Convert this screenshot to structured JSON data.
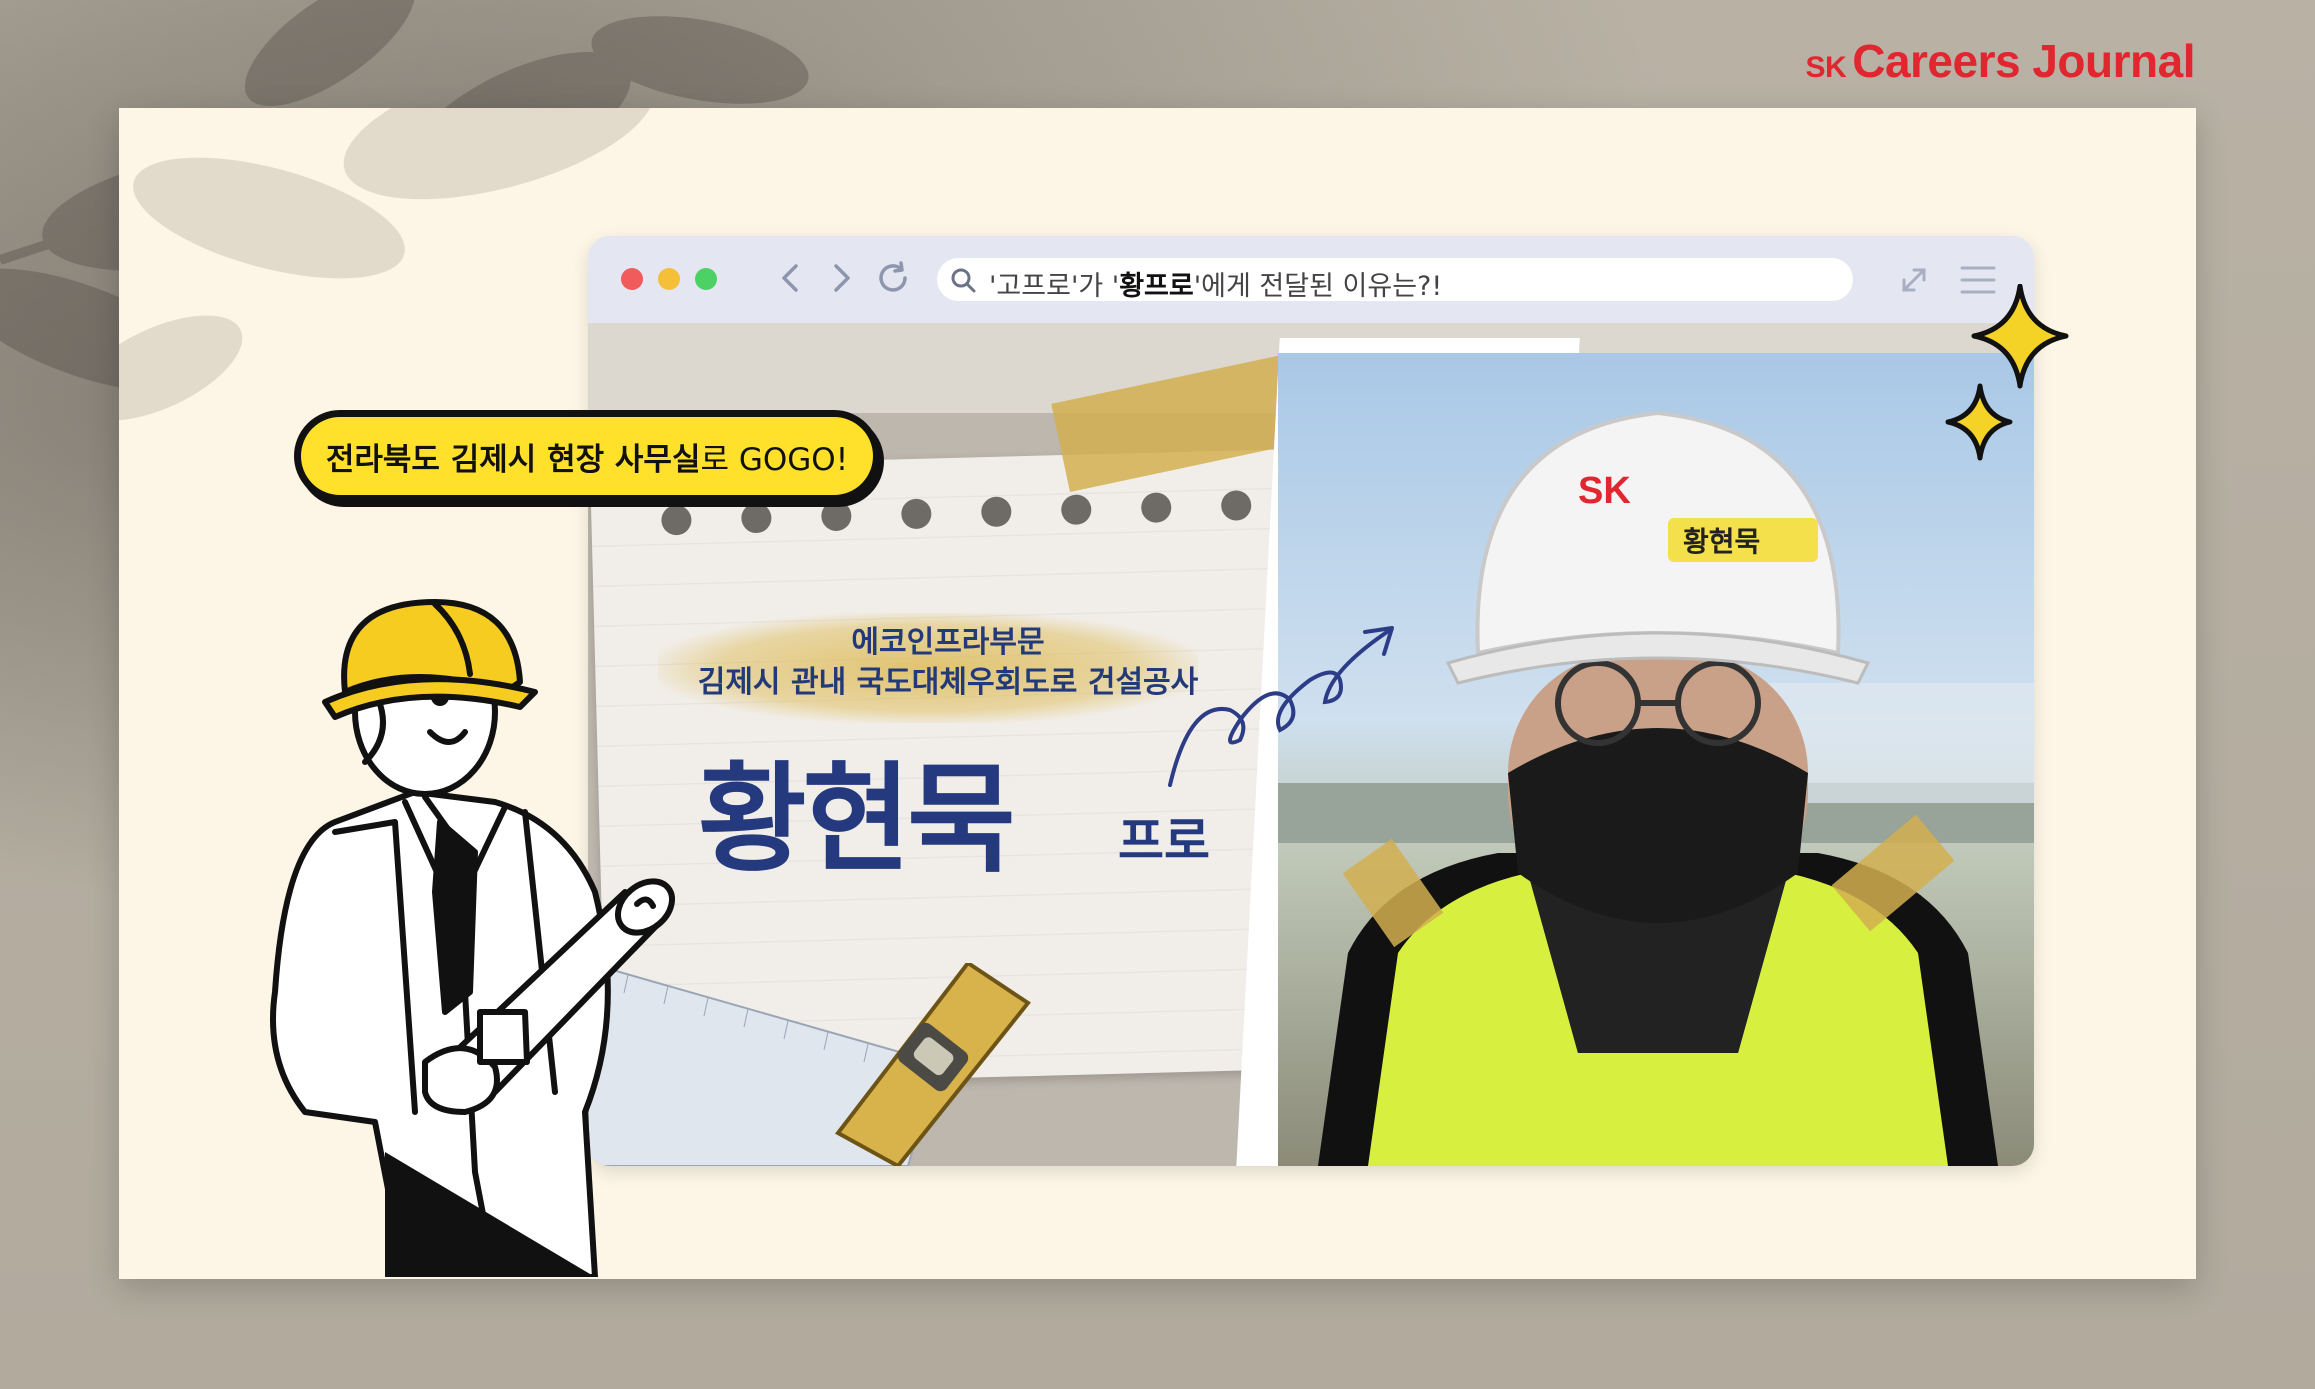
{
  "brand": {
    "prefix": "SK",
    "name": "Careers Journal",
    "color": "#e0262f"
  },
  "browser": {
    "address_parts": {
      "a": "'고프로'가 '",
      "b": "황프로",
      "c": "'에게 전달된 이유는?!"
    },
    "icons": [
      "back-icon",
      "forward-icon",
      "reload-icon",
      "search-icon",
      "expand-icon",
      "menu-icon"
    ]
  },
  "speech": {
    "bold": "전라북도 김제시 현장 사무실",
    "rest": "로 GOGO!"
  },
  "card": {
    "dept": "에코인프라부문",
    "project": "김제시 관내 국도대체우회도로 건설공사",
    "name": "황현묵",
    "suffix": "프로"
  },
  "helmet": {
    "logo": "SK",
    "name_tag": "황현묵"
  },
  "colors": {
    "paper": "#fdf6e6",
    "accent_yellow": "#ffe12b",
    "title_blue": "#25397e"
  }
}
